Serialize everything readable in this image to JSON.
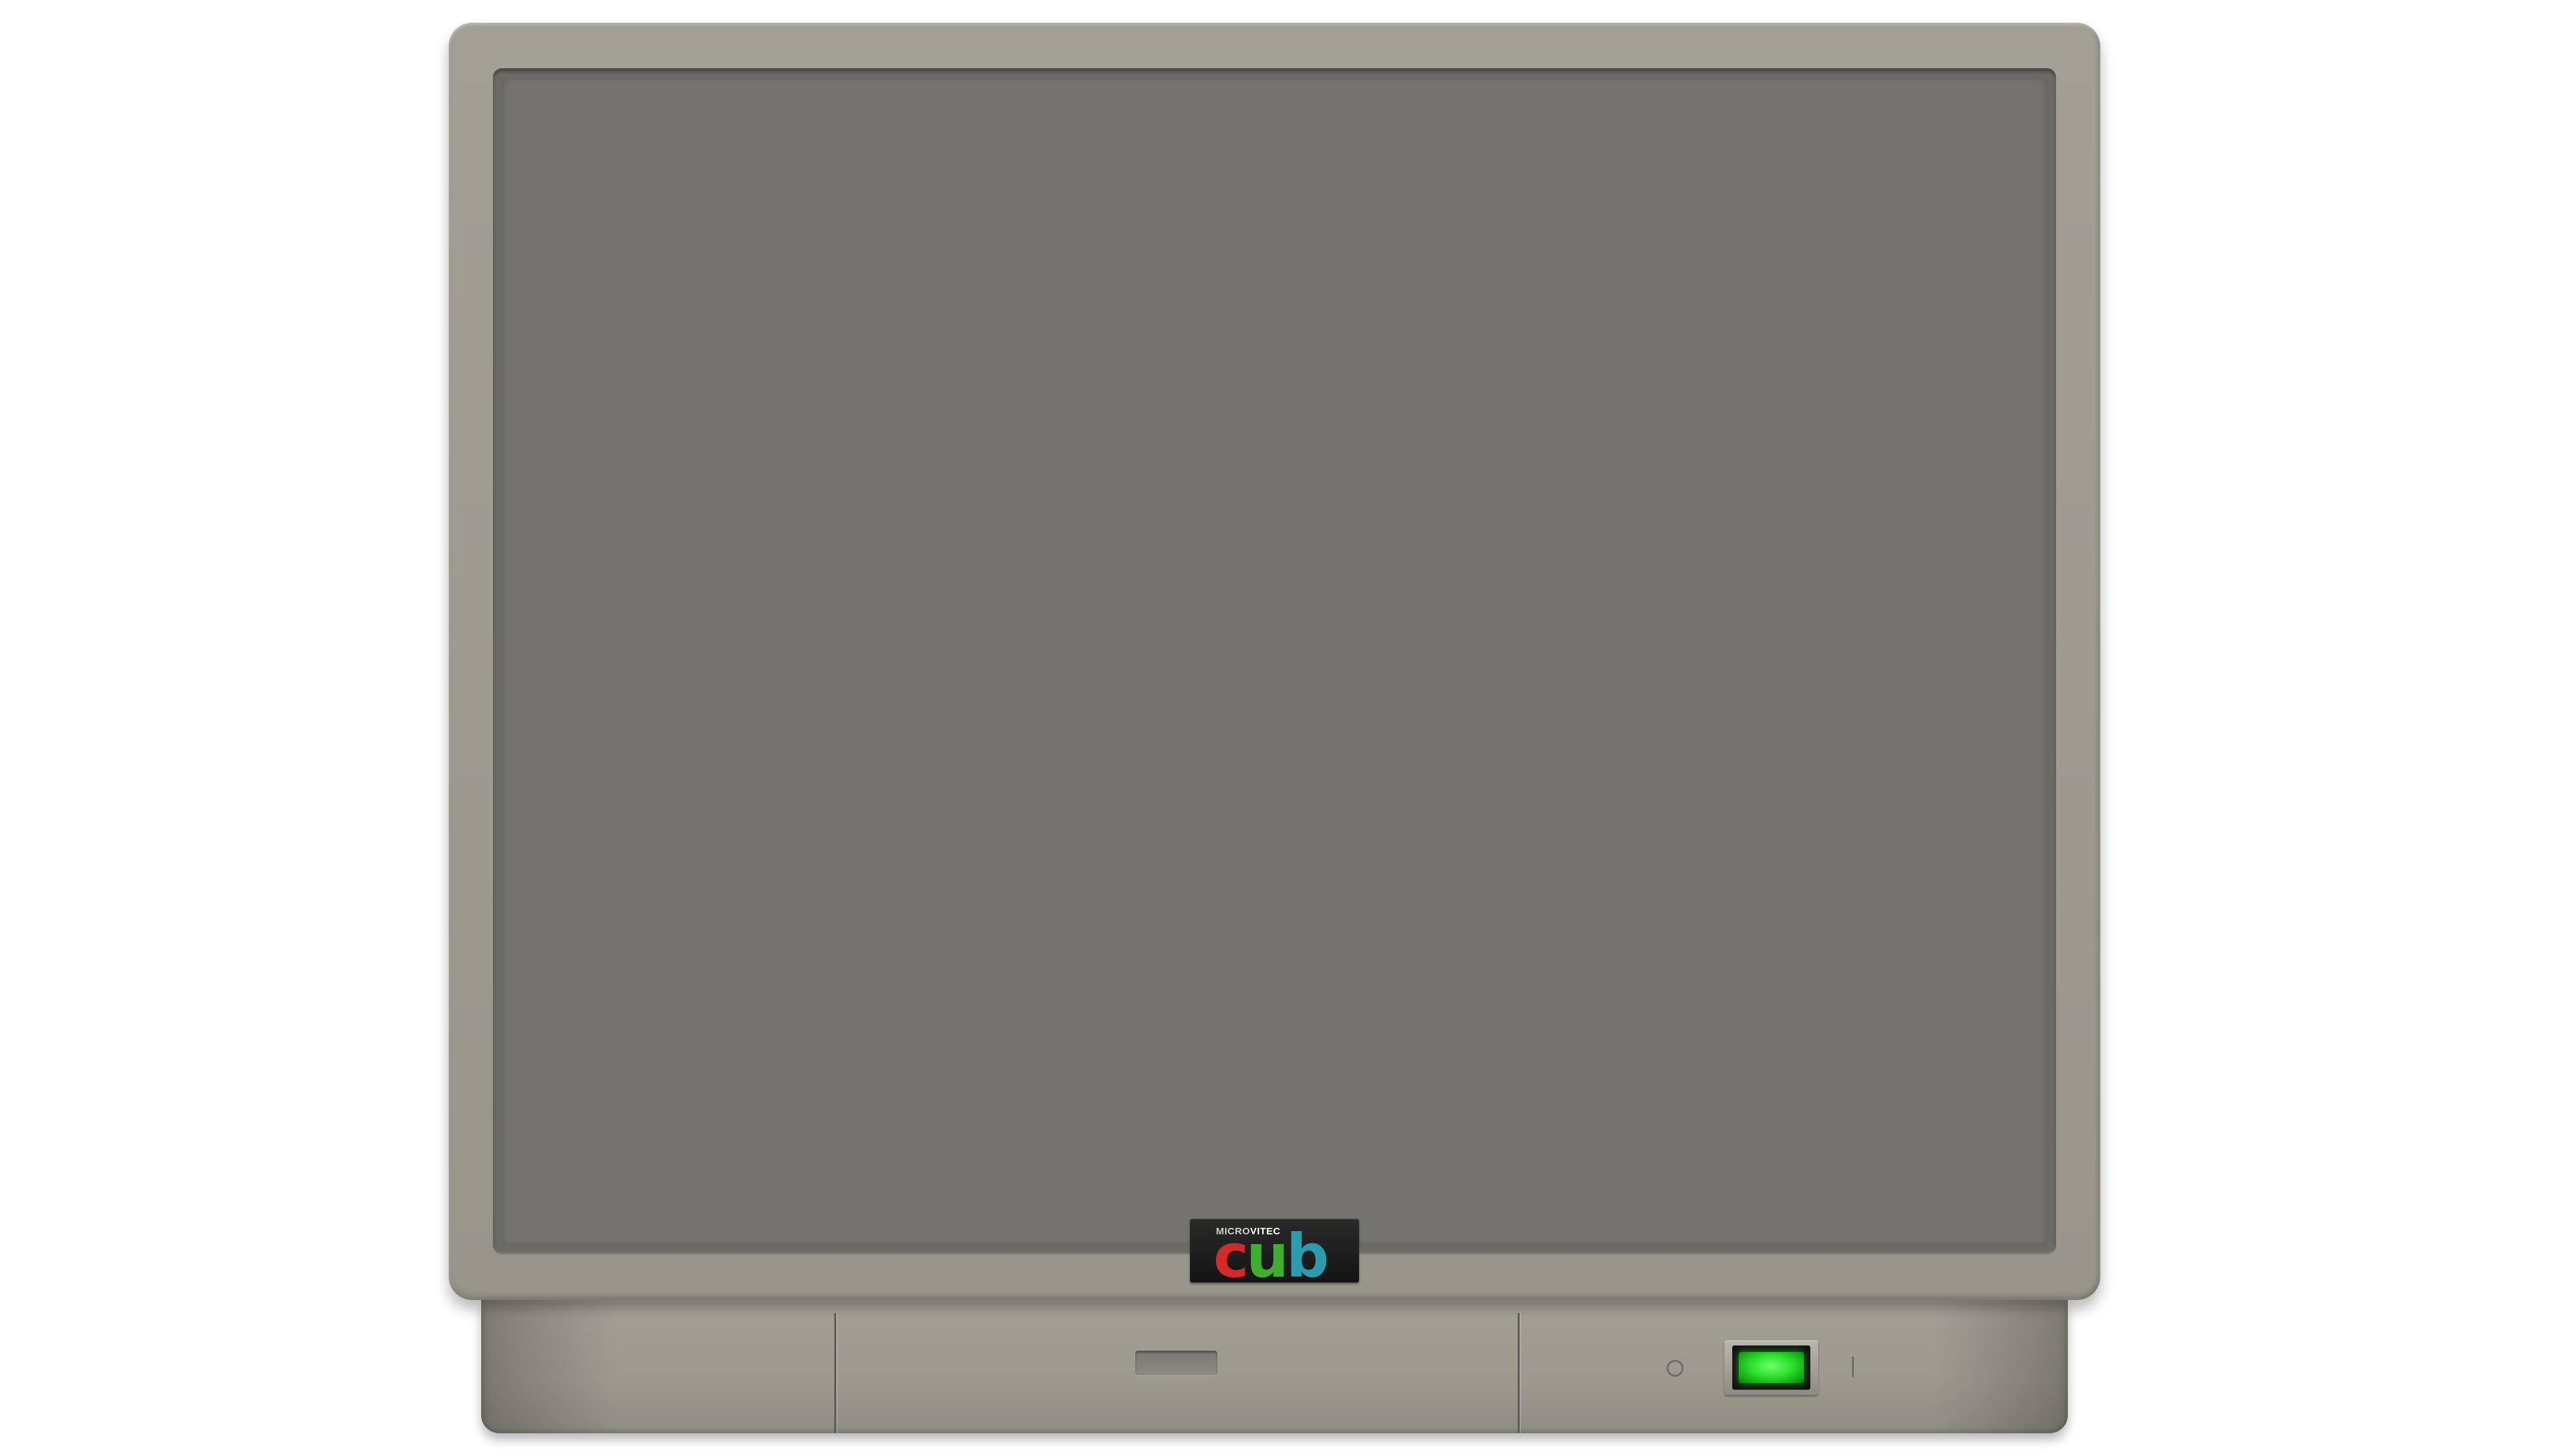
{
  "monitor": {
    "brand_prefix": "MICRO",
    "brand_suffix": "VITEC",
    "model_letters": [
      {
        "char": "c",
        "color": "#d42a2a"
      },
      {
        "char": "u",
        "color": "#3fae2f"
      },
      {
        "char": "b",
        "color": "#2b9bb0"
      }
    ],
    "screen_color": "#74736d",
    "bezel_color": "#9d9a90"
  },
  "power": {
    "state": "on",
    "lamp_color": "#2ce02c"
  }
}
